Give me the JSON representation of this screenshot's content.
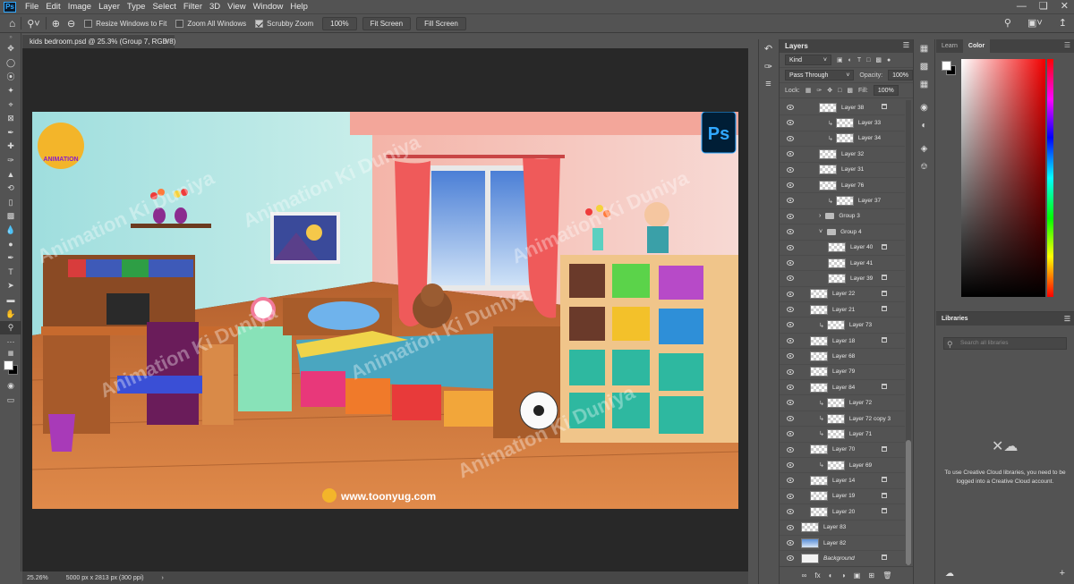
{
  "app": {
    "logo": "Ps"
  },
  "menu": [
    "File",
    "Edit",
    "Image",
    "Layer",
    "Type",
    "Select",
    "Filter",
    "3D",
    "View",
    "Window",
    "Help"
  ],
  "options": {
    "resize_windows": "Resize Windows to Fit",
    "zoom_all": "Zoom All Windows",
    "scrubby": "Scrubby Zoom",
    "zoom_pct": "100%",
    "fit_screen": "Fit Screen",
    "fill_screen": "Fill Screen"
  },
  "document": {
    "tab_title": "kids bedroom.psd @ 25.3% (Group 7, RGB/8)",
    "zoom_status": "25.26%",
    "dimensions_status": "5000 px x 2813 px (300 ppi)"
  },
  "artwork": {
    "watermark": "Animation Ki Duniya",
    "ps_badge": "Ps",
    "website": "www.toonyug.com",
    "logo_text": "ANIMATION"
  },
  "layers_panel": {
    "title": "Layers",
    "kind_label": "Kind",
    "blend_mode": "Pass Through",
    "opacity_label": "Opacity:",
    "opacity_value": "100%",
    "lock_label": "Lock:",
    "fill_label": "Fill:",
    "fill_value": "100%",
    "layers": [
      {
        "name": "Layer 38",
        "indent": 2,
        "clip": false,
        "lock": true,
        "type": "pixel"
      },
      {
        "name": "Layer 33",
        "indent": 3,
        "clip": true,
        "lock": false,
        "type": "pixel"
      },
      {
        "name": "Layer 34",
        "indent": 3,
        "clip": true,
        "lock": false,
        "type": "pixel"
      },
      {
        "name": "Layer 32",
        "indent": 2,
        "clip": false,
        "lock": false,
        "type": "pixel"
      },
      {
        "name": "Layer 31",
        "indent": 2,
        "clip": false,
        "lock": false,
        "type": "pixel"
      },
      {
        "name": "Layer 76",
        "indent": 2,
        "clip": false,
        "lock": false,
        "type": "pixel"
      },
      {
        "name": "Layer 37",
        "indent": 3,
        "clip": true,
        "lock": false,
        "type": "pixel"
      },
      {
        "name": "Group 3",
        "indent": 2,
        "clip": false,
        "lock": false,
        "type": "group"
      },
      {
        "name": "Group 4",
        "indent": 2,
        "clip": false,
        "lock": false,
        "type": "group-open"
      },
      {
        "name": "Layer 40",
        "indent": 3,
        "clip": false,
        "lock": true,
        "type": "pixel"
      },
      {
        "name": "Layer 41",
        "indent": 3,
        "clip": false,
        "lock": false,
        "type": "pixel"
      },
      {
        "name": "Layer 39",
        "indent": 3,
        "clip": false,
        "lock": true,
        "type": "pixel"
      },
      {
        "name": "Layer 22",
        "indent": 1,
        "clip": false,
        "lock": true,
        "type": "pixel"
      },
      {
        "name": "Layer 21",
        "indent": 1,
        "clip": false,
        "lock": true,
        "type": "pixel"
      },
      {
        "name": "Layer 73",
        "indent": 2,
        "clip": true,
        "lock": false,
        "type": "pixel"
      },
      {
        "name": "Layer 18",
        "indent": 1,
        "clip": false,
        "lock": true,
        "type": "pixel"
      },
      {
        "name": "Layer 68",
        "indent": 1,
        "clip": false,
        "lock": false,
        "type": "pixel"
      },
      {
        "name": "Layer 79",
        "indent": 1,
        "clip": false,
        "lock": false,
        "type": "pixel"
      },
      {
        "name": "Layer 84",
        "indent": 1,
        "clip": false,
        "lock": true,
        "type": "pixel"
      },
      {
        "name": "Layer 72",
        "indent": 2,
        "clip": true,
        "lock": false,
        "type": "pixel"
      },
      {
        "name": "Layer 72 copy 3",
        "indent": 2,
        "clip": true,
        "lock": false,
        "type": "pixel"
      },
      {
        "name": "Layer 71",
        "indent": 2,
        "clip": true,
        "lock": false,
        "type": "pixel"
      },
      {
        "name": "Layer 70",
        "indent": 1,
        "clip": false,
        "lock": true,
        "type": "pixel"
      },
      {
        "name": "Layer 69",
        "indent": 2,
        "clip": true,
        "lock": false,
        "type": "pixel"
      },
      {
        "name": "Layer 14",
        "indent": 1,
        "clip": false,
        "lock": true,
        "type": "pixel"
      },
      {
        "name": "Layer 19",
        "indent": 1,
        "clip": false,
        "lock": true,
        "type": "pixel"
      },
      {
        "name": "Layer 20",
        "indent": 1,
        "clip": false,
        "lock": true,
        "type": "pixel"
      },
      {
        "name": "Layer 83",
        "indent": 0,
        "clip": false,
        "lock": false,
        "type": "pixel"
      },
      {
        "name": "Layer 82",
        "indent": 0,
        "clip": false,
        "lock": false,
        "type": "pixel"
      },
      {
        "name": "Background",
        "indent": 0,
        "clip": false,
        "lock": true,
        "type": "pixel"
      }
    ]
  },
  "color_panel": {
    "tab_learn": "Learn",
    "tab_color": "Color",
    "fg": "#ffffff",
    "bg": "#000000"
  },
  "libraries": {
    "title": "Libraries",
    "search_placeholder": "Search all libraries",
    "message": "To use Creative Cloud libraries, you need to be logged into a Creative Cloud account."
  }
}
